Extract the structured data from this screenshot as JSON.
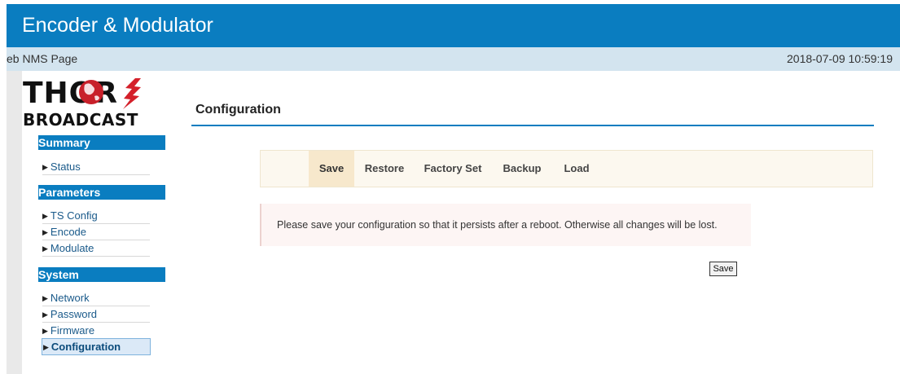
{
  "header": {
    "title": "Encoder & Modulator"
  },
  "subbar": {
    "left_text": "eb NMS Page",
    "datetime": "2018-07-09 10:59:19"
  },
  "logo": {
    "line1": "THOR",
    "line2": "BROADCAST"
  },
  "sidebar": {
    "sections": [
      {
        "title": "Summary",
        "items": [
          "Status"
        ]
      },
      {
        "title": "Parameters",
        "items": [
          "TS Config",
          "Encode",
          "Modulate"
        ]
      },
      {
        "title": "System",
        "items": [
          "Network",
          "Password",
          "Firmware",
          "Configuration"
        ]
      }
    ],
    "active_item": "Configuration"
  },
  "main": {
    "title": "Configuration",
    "tabs": [
      "Save",
      "Restore",
      "Factory Set",
      "Backup",
      "Load"
    ],
    "active_tab": "Save",
    "alert_text": "Please save your configuration so that it persists after a reboot. Otherwise all changes will be lost.",
    "save_button": "Save"
  },
  "colors": {
    "header_bg": "#0a7dc0",
    "subbar_bg": "#d3e4ef",
    "tab_active_bg": "#f7e8cc"
  }
}
